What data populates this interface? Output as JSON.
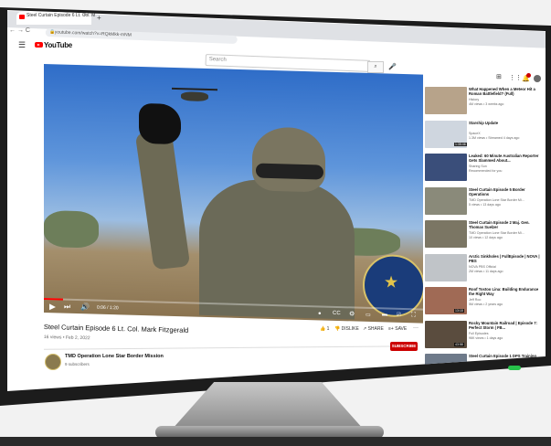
{
  "browser": {
    "tab_title": "Steel Curtain Episode 6 Lt. Col. M",
    "tab_close": "×",
    "new_tab": "+",
    "nav_glyphs": "← → C",
    "url": "youtube.com/watch?v=RQkMkk-mNM"
  },
  "topbar": {
    "logo_text": "YouTube",
    "search_placeholder": "Search",
    "search_icon": "search-icon",
    "mic_icon": "mic-icon"
  },
  "player": {
    "time": "0:06 / 1:20",
    "progress": 0.05,
    "seal_text": "TEXAS MILITARY DEPARTMENT"
  },
  "video": {
    "title": "Steel Curtain Episode 6 Lt. Col. Mark Fitzgerald",
    "meta": "16 views • Feb 2, 2022",
    "like_count": "1",
    "dislike_label": "DISLIKE",
    "share_label": "SHARE",
    "save_label": "SAVE"
  },
  "channel": {
    "name": "TMD Operation Lone Star Border Mission",
    "subscribers": "9 subscribers",
    "subscribe_label": "SUBSCRIBE"
  },
  "recommendations": [
    {
      "title": "What Happened When a Meteor Hit a Roman Battlefield? (Full)",
      "channel": "History",
      "views": "4M views • 3 weeks ago",
      "duration": "",
      "thumb_color": "#b7a38a"
    },
    {
      "title": "Starship Update",
      "channel": "SpaceX",
      "views": "1.3M views • Streamed 4 days ago",
      "duration": "1:35:46",
      "thumb_color": "#cfd6df"
    },
    {
      "title": "Leaked: 60 Minute Australian Reporter Gets Slammed About...",
      "channel": "Sharing Sun",
      "views": "Recommended for you",
      "duration": "",
      "thumb_color": "#3a4e7a"
    },
    {
      "title": "Steel Curtain Episode 5 Border Operations",
      "channel": "TMD Operation Lone Star Border Mi...",
      "views": "5 views • 13 days ago",
      "duration": "",
      "thumb_color": "#8a8a7a"
    },
    {
      "title": "Steel Curtain Episode 2 Maj. Gen. Thomas Suelzer",
      "channel": "TMD Operation Lone Star Border Mi...",
      "views": "10 views • 12 days ago",
      "duration": "",
      "thumb_color": "#7b7664"
    },
    {
      "title": "Arctic Sinkholes | FullEpisode | NOVA | PBS",
      "channel": "NOVA PBS Official",
      "views": "2M views • 11 days ago",
      "duration": "",
      "thumb_color": "#c0c4c8"
    },
    {
      "title": "Roof Tostoo Lina: Building Endurance the Right Way",
      "channel": "Jeff Roo",
      "views": "5M views • 2 years ago",
      "duration": "13:18",
      "thumb_color": "#a06a55"
    },
    {
      "title": "Rocky Mountain Railroad | Episode 7: Perfect Storm | FB...",
      "channel": "Full Episodes",
      "views": "96K views • 1 days ago",
      "duration": "43:58",
      "thumb_color": "#5a4c3e"
    },
    {
      "title": "Steel Curtain Episode 1 DPS Training",
      "channel": "TMD Operation Lone Star Border Mi...",
      "views": "",
      "duration": "",
      "thumb_color": "#6e7a8a"
    }
  ]
}
